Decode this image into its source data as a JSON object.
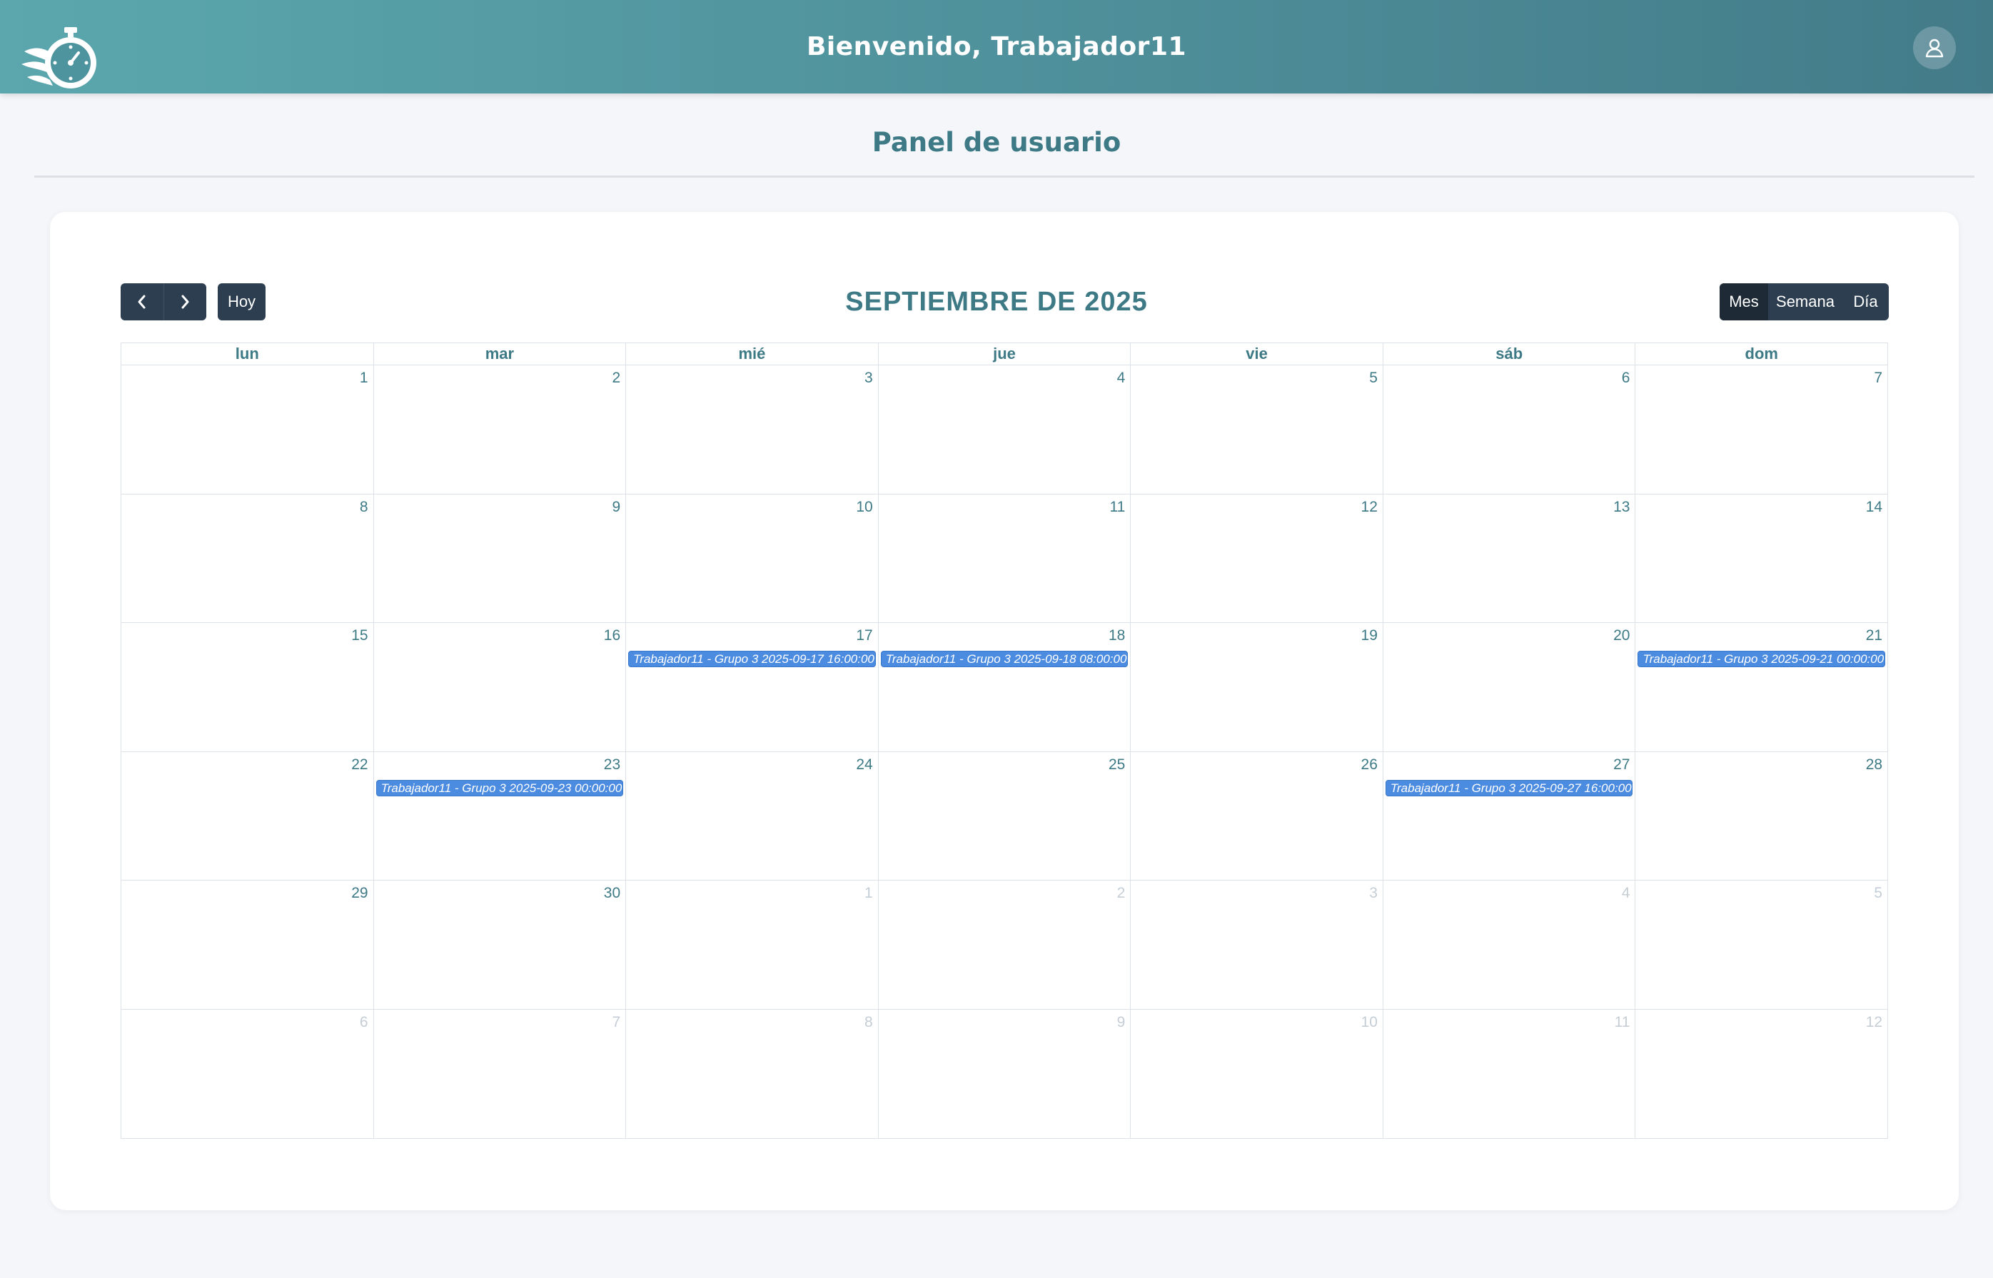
{
  "header": {
    "title": "Bienvenido, Trabajador11",
    "logo_icon": "stopwatch-logo-icon",
    "user_icon": "user-icon"
  },
  "page_title": "Panel de usuario",
  "calendar": {
    "title": "SEPTIEMBRE DE 2025",
    "prev_icon": "chevron-left-icon",
    "next_icon": "chevron-right-icon",
    "today_label": "Hoy",
    "views": [
      {
        "label": "Mes",
        "active": true
      },
      {
        "label": "Semana",
        "active": false
      },
      {
        "label": "Día",
        "active": false
      }
    ],
    "weekdays": [
      "lun",
      "mar",
      "mié",
      "jue",
      "vie",
      "sáb",
      "dom"
    ],
    "weeks": [
      [
        {
          "n": "1"
        },
        {
          "n": "2"
        },
        {
          "n": "3"
        },
        {
          "n": "4"
        },
        {
          "n": "5"
        },
        {
          "n": "6"
        },
        {
          "n": "7"
        }
      ],
      [
        {
          "n": "8"
        },
        {
          "n": "9"
        },
        {
          "n": "10"
        },
        {
          "n": "11"
        },
        {
          "n": "12"
        },
        {
          "n": "13"
        },
        {
          "n": "14"
        }
      ],
      [
        {
          "n": "15"
        },
        {
          "n": "16"
        },
        {
          "n": "17",
          "event": "Trabajador11 - Grupo 3 2025-09-17 16:00:00"
        },
        {
          "n": "18",
          "event": "Trabajador11 - Grupo 3 2025-09-18 08:00:00"
        },
        {
          "n": "19"
        },
        {
          "n": "20"
        },
        {
          "n": "21",
          "event": "Trabajador11 - Grupo 3 2025-09-21 00:00:00"
        }
      ],
      [
        {
          "n": "22"
        },
        {
          "n": "23",
          "event": "Trabajador11 - Grupo 3 2025-09-23 00:00:00"
        },
        {
          "n": "24"
        },
        {
          "n": "25"
        },
        {
          "n": "26"
        },
        {
          "n": "27",
          "event": "Trabajador11 - Grupo 3 2025-09-27 16:00:00"
        },
        {
          "n": "28"
        }
      ],
      [
        {
          "n": "29"
        },
        {
          "n": "30"
        },
        {
          "n": "1",
          "off": true
        },
        {
          "n": "2",
          "off": true
        },
        {
          "n": "3",
          "off": true
        },
        {
          "n": "4",
          "off": true
        },
        {
          "n": "5",
          "off": true
        }
      ],
      [
        {
          "n": "6",
          "off": true
        },
        {
          "n": "7",
          "off": true
        },
        {
          "n": "8",
          "off": true
        },
        {
          "n": "9",
          "off": true
        },
        {
          "n": "10",
          "off": true
        },
        {
          "n": "11",
          "off": true
        },
        {
          "n": "12",
          "off": true
        }
      ]
    ]
  },
  "colors": {
    "header_start": "#5ba7ad",
    "header_end": "#437b89",
    "accent_text": "#3d7a86",
    "button_dark": "#2c3e50",
    "event_blue": "#4b8be0"
  }
}
